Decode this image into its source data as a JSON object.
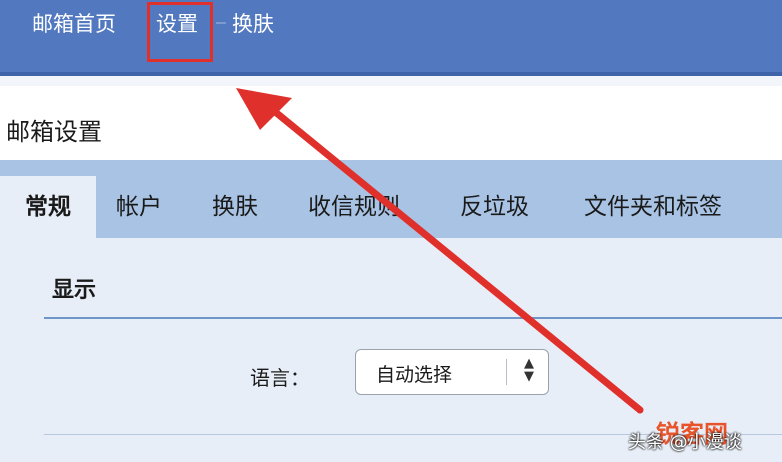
{
  "topnav": {
    "home": "邮箱首页",
    "settings": "设置",
    "skin": "换肤"
  },
  "page": {
    "title": "邮箱设置"
  },
  "tabs": [
    {
      "label": "常规",
      "active": true
    },
    {
      "label": "帐户",
      "active": false
    },
    {
      "label": "换肤",
      "active": false
    },
    {
      "label": "收信规则",
      "active": false
    },
    {
      "label": "反垃圾",
      "active": false
    },
    {
      "label": "文件夹和标签",
      "active": false
    }
  ],
  "display_section": {
    "title": "显示",
    "language_label": "语言：",
    "language_value": "自动选择"
  },
  "watermark": {
    "text": "头条 @小漫谈",
    "logo": "锐客网"
  },
  "colors": {
    "nav_bg": "#5279bf",
    "tab_bar": "#a8c3e3",
    "content_bg": "#e8eef7",
    "annotation_red": "#e0302b"
  }
}
